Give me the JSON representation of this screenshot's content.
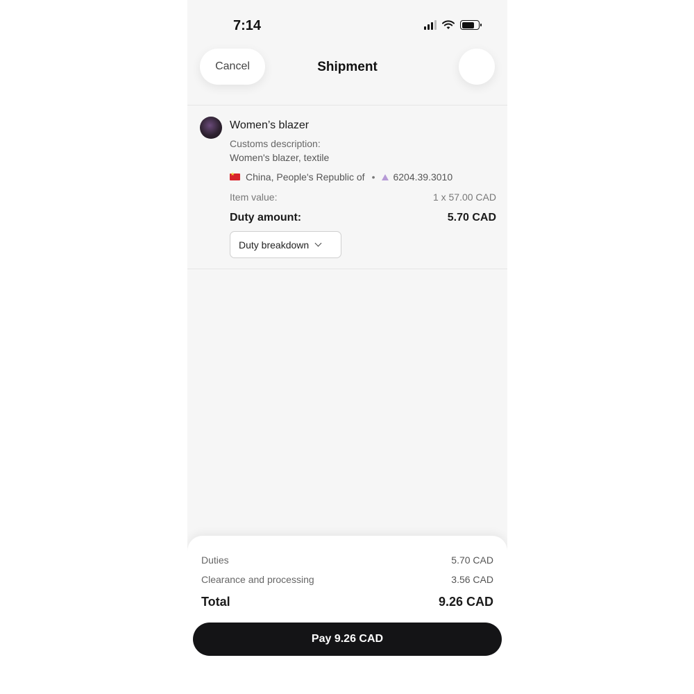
{
  "status_bar": {
    "time": "7:14",
    "icons": [
      "cellular-signal-icon",
      "wifi-icon",
      "battery-icon"
    ]
  },
  "nav": {
    "cancel_label": "Cancel",
    "title": "Shipment"
  },
  "item": {
    "name": "Women’s blazer",
    "customs_label": "Customs description:",
    "customs_value": "Women's blazer, textile",
    "origin": "China, People's Republic of",
    "separator": "•",
    "hs_code": "6204.39.3010",
    "value_label": "Item value:",
    "value_amount": "1 x 57.00 CAD",
    "duty_label": "Duty amount:",
    "duty_amount": "5.70 CAD",
    "breakdown_label": "Duty breakdown"
  },
  "summary": {
    "rows": [
      {
        "label": "Duties",
        "value": "5.70 CAD"
      },
      {
        "label": "Clearance and processing",
        "value": "3.56 CAD"
      }
    ],
    "total_label": "Total",
    "total_value": "9.26 CAD",
    "pay_label": "Pay 9.26 CAD"
  },
  "colors": {
    "background": "#f6f6f6",
    "pay_button": "#141416",
    "flag_red": "#d8242b"
  }
}
